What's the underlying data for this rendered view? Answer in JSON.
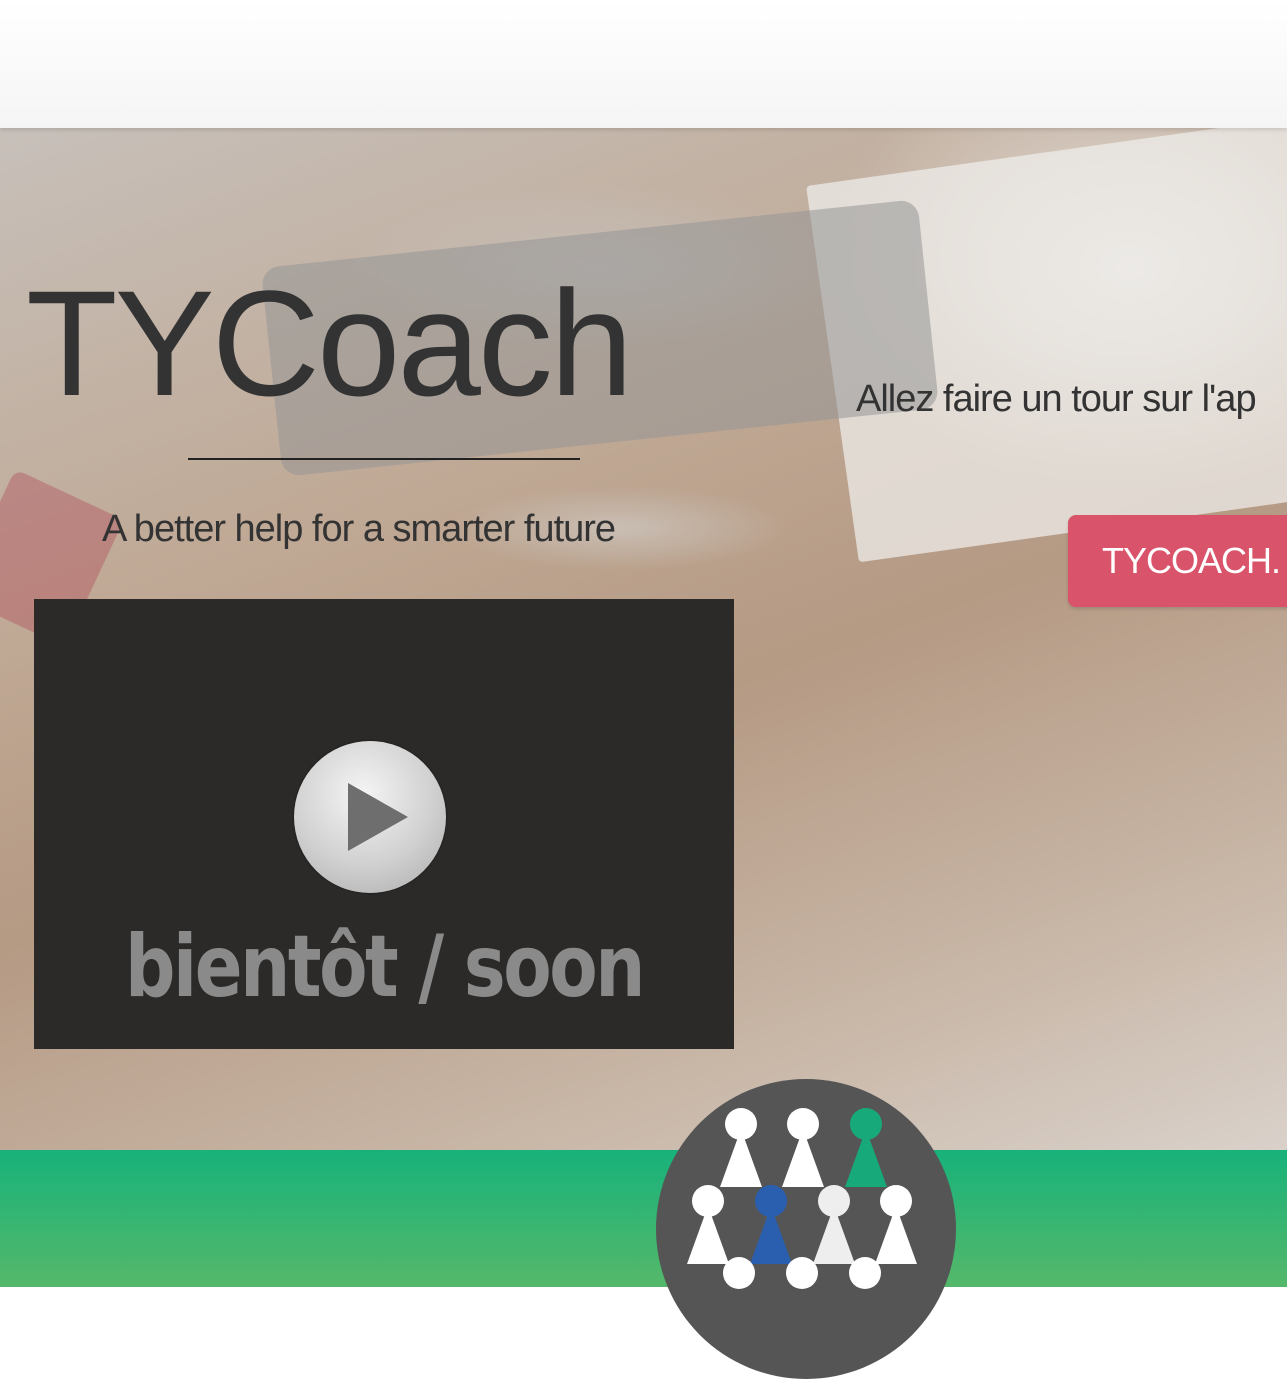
{
  "hero": {
    "title": "TYCoach",
    "tagline": "A better help for a smarter future",
    "visit_text": "Allez faire un tour sur l'ap",
    "visit_button_label": "TYCOACH."
  },
  "video": {
    "overlay_text": "bientôt / soon"
  },
  "colors": {
    "accent_button": "#d9536a",
    "footer_green": "#17b27a",
    "logo_bg": "#555555",
    "pawn_white": "#ffffff",
    "pawn_green": "#17a97a",
    "pawn_blue": "#2a5fb0"
  },
  "icons": {
    "video": "play-icon",
    "logo": "pawns-logo-icon"
  }
}
